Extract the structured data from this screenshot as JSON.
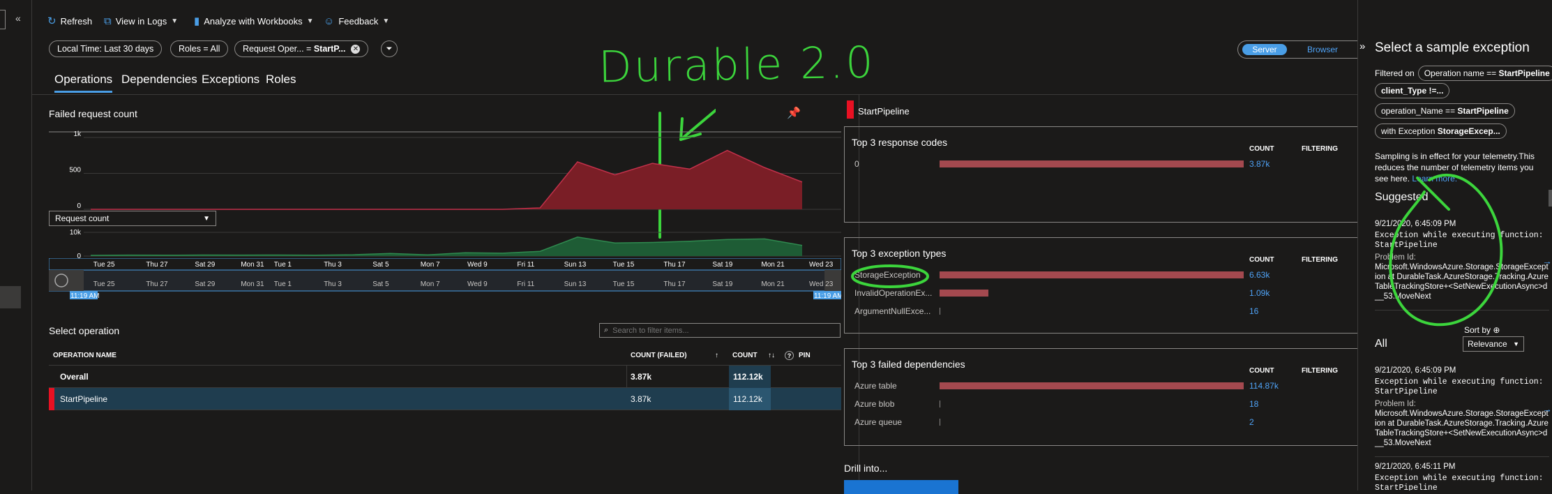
{
  "toolbar": {
    "refresh": "Refresh",
    "view_in_logs": "View in Logs",
    "analyze": "Analyze with Workbooks",
    "feedback": "Feedback"
  },
  "filters": {
    "time": "Local Time: Last 30 days",
    "roles": "Roles = All",
    "request_prefix": "Request Oper...",
    "request_eq": " = ",
    "request_value": "StartP..."
  },
  "toggle": {
    "server": "Server",
    "browser": "Browser"
  },
  "tabs": [
    "Operations",
    "Dependencies",
    "Exceptions",
    "Roles"
  ],
  "annotation": "Durable 2.0",
  "charts": {
    "failed_title": "Failed request count",
    "failed_yticks": [
      "1k",
      "500",
      "0"
    ],
    "metric_select": "Request count",
    "req_yticks": [
      "10k",
      "0"
    ],
    "xticks": [
      "Tue 25",
      "Thu 27",
      "Sat 29",
      "Mon 31",
      "Tue 1",
      "Thu 3",
      "Sat 5",
      "Mon 7",
      "Wed 9",
      "Fri 11",
      "Sun 13",
      "Tue 15",
      "Thu 17",
      "Sat 19",
      "Mon 21",
      "Wed 23"
    ],
    "brush_start": "11:19 AM",
    "brush_end": "11:19 AM"
  },
  "chart_data": [
    {
      "type": "area",
      "title": "Failed request count",
      "ylim": [
        0,
        1000
      ],
      "x": [
        "Tue 25",
        "Thu 27",
        "Sat 29",
        "Mon 31",
        "Tue 1",
        "Thu 3",
        "Sat 5",
        "Mon 7",
        "Wed 9",
        "Fri 11",
        "Sun 13",
        "Tue 15",
        "Wed 16",
        "Thu 17",
        "Fri 18",
        "Sat 19",
        "Sun 20",
        "Mon 21",
        "Tue 22",
        "Wed 23"
      ],
      "values": [
        0,
        0,
        0,
        0,
        0,
        0,
        0,
        0,
        0,
        0,
        0,
        0,
        20,
        660,
        480,
        640,
        560,
        820,
        580,
        380
      ],
      "color": "#7a1e26"
    },
    {
      "type": "area",
      "series": [
        {
          "name": "Request count",
          "values": [
            600,
            800,
            700,
            900,
            800,
            900,
            700,
            1100,
            2200,
            1000,
            2800,
            2400,
            4000,
            16000,
            11000,
            11500,
            12500,
            14000,
            14500,
            9000
          ]
        }
      ],
      "x": [
        "Tue 25",
        "Thu 27",
        "Sat 29",
        "Mon 31",
        "Tue 1",
        "Thu 3",
        "Sat 5",
        "Mon 7",
        "Wed 9",
        "Fri 11",
        "Sun 13",
        "Tue 15",
        "Wed 16",
        "Thu 17",
        "Fri 18",
        "Sat 19",
        "Sun 20",
        "Mon 21",
        "Tue 22",
        "Wed 23"
      ],
      "ylim": [
        0,
        20000
      ],
      "color": "#1e5c35"
    }
  ],
  "operations": {
    "title": "Select operation",
    "search_placeholder": "Search to filter items...",
    "columns": [
      "OPERATION NAME",
      "COUNT (FAILED)",
      "COUNT",
      "PIN"
    ],
    "rows": [
      {
        "name": "Overall",
        "failed": "3.87k",
        "count": "112.12k"
      },
      {
        "name": "StartPipeline",
        "failed": "3.87k",
        "count": "112.12k"
      }
    ]
  },
  "detail": {
    "operation": "StartPipeline",
    "count_header": "COUNT",
    "filtering_header": "FILTERING",
    "response_codes": {
      "title": "Top 3 response codes",
      "items": [
        {
          "name": "0",
          "count": "3.87k",
          "frac": 1.0
        }
      ]
    },
    "exception_types": {
      "title": "Top 3 exception types",
      "items": [
        {
          "name": "StorageException",
          "count": "6.63k",
          "frac": 1.0
        },
        {
          "name": "InvalidOperationEx...",
          "count": "1.09k",
          "frac": 0.16
        },
        {
          "name": "ArgumentNullExce...",
          "count": "16",
          "frac": 0.0
        }
      ]
    },
    "failed_deps": {
      "title": "Top 3 failed dependencies",
      "items": [
        {
          "name": "Azure table",
          "count": "114.87k",
          "frac": 1.0
        },
        {
          "name": "Azure blob",
          "count": "18",
          "frac": 0.0
        },
        {
          "name": "Azure queue",
          "count": "2",
          "frac": 0.0
        }
      ]
    },
    "drill": "Drill into..."
  },
  "sample_panel": {
    "title": "Select a sample exception",
    "filtered_on": "Filtered on",
    "tags": [
      {
        "key": "Operation name == ",
        "val": "StartPipeline"
      },
      {
        "key": "",
        "val": "client_Type !=..."
      },
      {
        "key": "operation_Name == ",
        "val": "StartPipeline"
      },
      {
        "key": "with Exception ",
        "val": "StorageExcep..."
      }
    ],
    "sampling_note": "Sampling is in effect for your telemetry.This reduces the number of telemetry items you see here.",
    "learn_more": "Learn more.",
    "suggested": "Suggested",
    "sort_by": "Sort by",
    "sort_value": "Relevance",
    "all": "All",
    "items": [
      {
        "time": "9/21/2020, 6:45:09 PM",
        "msg": "Exception while executing function: StartPipeline",
        "label": "Problem Id:",
        "problem": "Microsoft.WindowsAzure.Storage.StorageException at DurableTask.AzureStorage.Tracking.AzureTableTrackingStore+<SetNewExecutionAsync>d__53.MoveNext"
      },
      {
        "time": "9/21/2020, 6:45:09 PM",
        "msg": "Exception while executing function: StartPipeline",
        "label": "Problem Id:",
        "problem": "Microsoft.WindowsAzure.Storage.StorageException at DurableTask.AzureStorage.Tracking.AzureTableTrackingStore+<SetNewExecutionAsync>d__53.MoveNext"
      },
      {
        "time": "9/21/2020, 6:45:11 PM",
        "msg": "Exception while executing function: StartPipeline"
      }
    ]
  }
}
